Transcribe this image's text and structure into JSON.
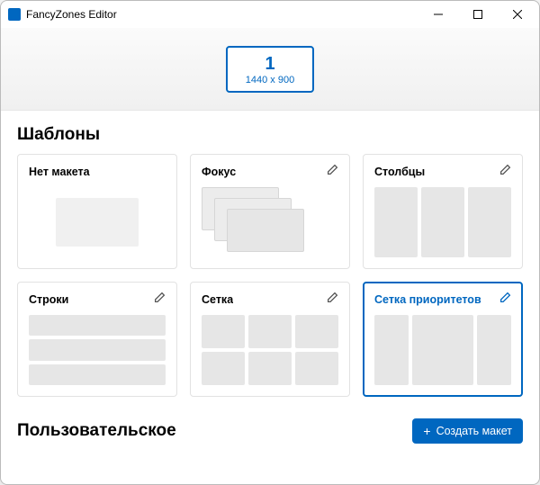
{
  "window": {
    "title": "FancyZones Editor"
  },
  "monitor": {
    "number": "1",
    "resolution": "1440 x 900"
  },
  "sections": {
    "templates_title": "Шаблоны",
    "custom_title": "Пользовательское"
  },
  "templates": [
    {
      "id": "none",
      "label": "Нет макета",
      "editable": false,
      "selected": false
    },
    {
      "id": "focus",
      "label": "Фокус",
      "editable": true,
      "selected": false
    },
    {
      "id": "columns",
      "label": "Столбцы",
      "editable": true,
      "selected": false
    },
    {
      "id": "rows",
      "label": "Строки",
      "editable": true,
      "selected": false
    },
    {
      "id": "grid",
      "label": "Сетка",
      "editable": true,
      "selected": false
    },
    {
      "id": "priority",
      "label": "Сетка приоритетов",
      "editable": true,
      "selected": true
    }
  ],
  "buttons": {
    "create_layout": "Создать макет"
  },
  "colors": {
    "accent": "#0067c0"
  }
}
